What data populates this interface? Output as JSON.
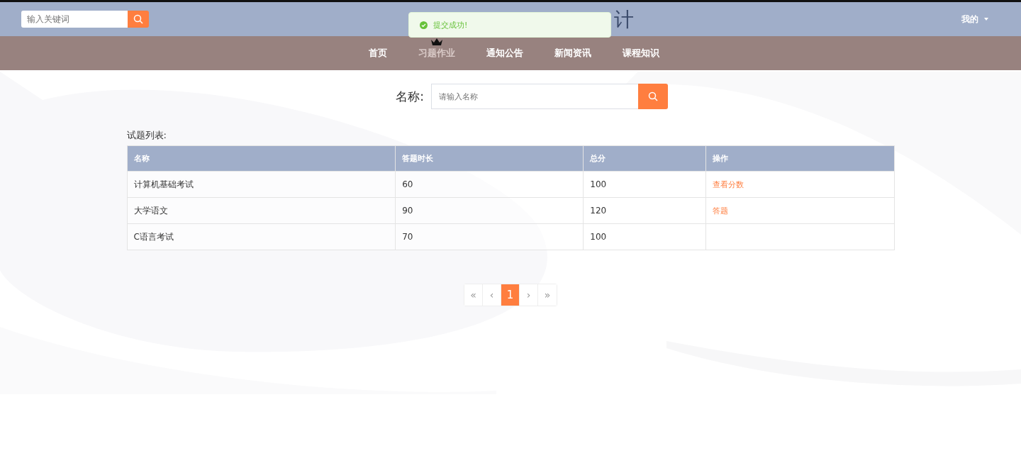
{
  "header": {
    "search": {
      "placeholder": "输入关键词"
    },
    "title_fragment": "计",
    "user_menu": "我的"
  },
  "toast": {
    "message": "提交成功!"
  },
  "nav": [
    {
      "label": "首页",
      "selected": false
    },
    {
      "label": "习题作业",
      "selected": true
    },
    {
      "label": "通知公告",
      "selected": false
    },
    {
      "label": "新闻资讯",
      "selected": false
    },
    {
      "label": "课程知识",
      "selected": false
    }
  ],
  "filter": {
    "label": "名称:",
    "placeholder": "请输入名称"
  },
  "table": {
    "caption": "试题列表:",
    "columns": [
      "名称",
      "答题时长",
      "总分",
      "操作"
    ],
    "rows": [
      {
        "cells": [
          "计算机基础考试",
          "60",
          "100"
        ],
        "action": "查看分数"
      },
      {
        "cells": [
          "大学语文",
          "90",
          "120"
        ],
        "action": "答题"
      },
      {
        "cells": [
          "C语言考试",
          "70",
          "100"
        ]
      }
    ]
  },
  "pagination": [
    {
      "label": "«",
      "selected": false
    },
    {
      "label": "‹",
      "selected": false
    },
    {
      "label": "1",
      "selected": true
    },
    {
      "label": "›",
      "selected": false
    },
    {
      "label": "»",
      "selected": false
    }
  ]
}
